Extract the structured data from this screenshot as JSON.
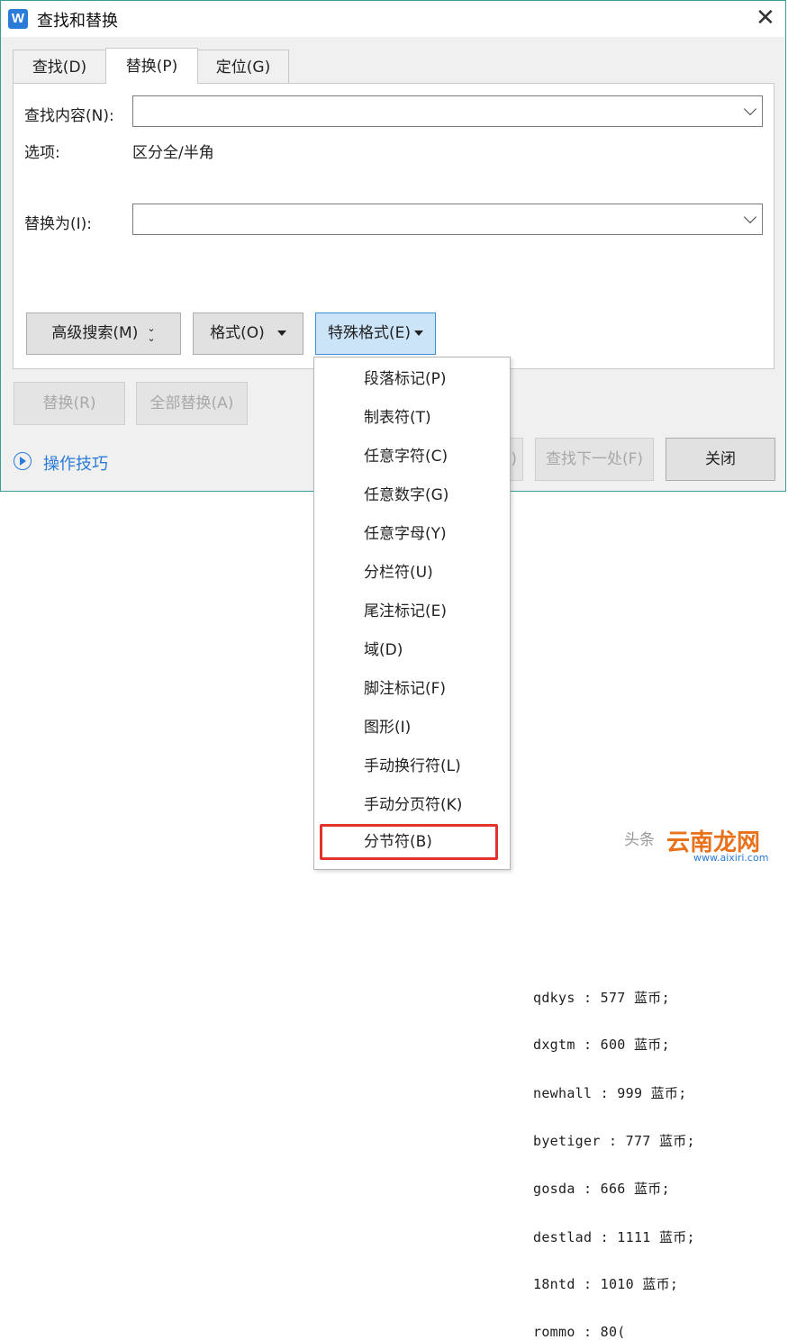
{
  "window": {
    "title": "查找和替换",
    "app_icon_letter": "W",
    "close_glyph": "✕"
  },
  "tabs": [
    {
      "label": "查找(D)",
      "active": false
    },
    {
      "label": "替换(P)",
      "active": true
    },
    {
      "label": "定位(G)",
      "active": false
    }
  ],
  "form": {
    "find_label": "查找内容(N):",
    "find_value": "",
    "options_label": "选项:",
    "options_value": "区分全/半角",
    "replace_label": "替换为(I):",
    "replace_value": ""
  },
  "buttons": {
    "advanced_search": "高级搜索(M)",
    "format": "格式(O)",
    "special_format": "特殊格式(E)",
    "replace": "替换(R)",
    "replace_all": "全部替换(A)",
    "find_prev_partial": ")",
    "find_next": "查找下一处(F)",
    "close": "关闭"
  },
  "tips": {
    "label": "操作技巧"
  },
  "special_menu": {
    "items": [
      "段落标记(P)",
      "制表符(T)",
      "任意字符(C)",
      "任意数字(G)",
      "任意字母(Y)",
      "分栏符(U)",
      "尾注标记(E)",
      "域(D)",
      "脚注标记(F)",
      "图形(I)",
      "手动换行符(L)",
      "手动分页符(K)",
      "分节符(B)"
    ],
    "highlighted_index": 12,
    "highlight_color": "#e0332e"
  },
  "document": {
    "lines": [
      "qdkys : 577 蓝币;",
      "dxgtm : 600 蓝币;",
      "newhall : 999 蓝币;",
      "byetiger : 777 蓝币;",
      "gosda : 666 蓝币;",
      "destlad : 1111 蓝币;",
      "18ntd : 1010 蓝币;",
      "rommo : 80("
    ]
  },
  "watermark": {
    "ghost": "头条",
    "text": "云南龙网",
    "url": "www.aixiri.com"
  },
  "colors": {
    "accent": "#2b7bd9",
    "dialog_border": "#3a9e98",
    "pressed_button": "#cce4f7"
  }
}
